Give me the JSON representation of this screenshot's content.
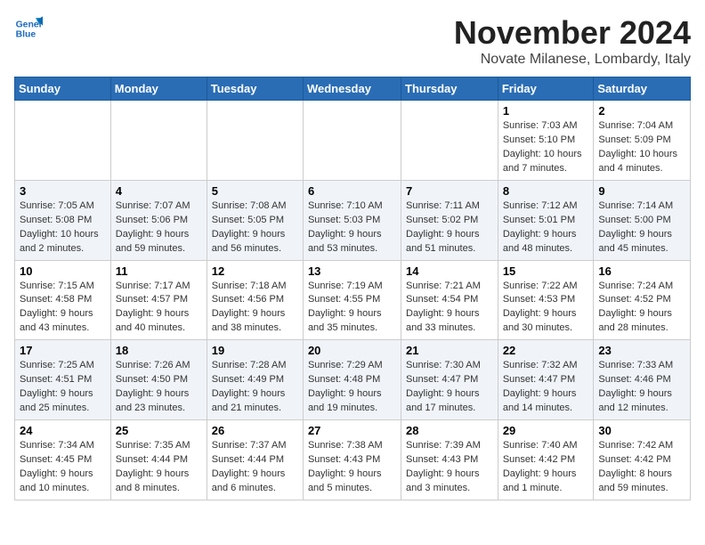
{
  "logo": {
    "line1": "General",
    "line2": "Blue"
  },
  "title": "November 2024",
  "location": "Novate Milanese, Lombardy, Italy",
  "headers": [
    "Sunday",
    "Monday",
    "Tuesday",
    "Wednesday",
    "Thursday",
    "Friday",
    "Saturday"
  ],
  "rows": [
    [
      {
        "day": "",
        "info": ""
      },
      {
        "day": "",
        "info": ""
      },
      {
        "day": "",
        "info": ""
      },
      {
        "day": "",
        "info": ""
      },
      {
        "day": "",
        "info": ""
      },
      {
        "day": "1",
        "info": "Sunrise: 7:03 AM\nSunset: 5:10 PM\nDaylight: 10 hours and 7 minutes."
      },
      {
        "day": "2",
        "info": "Sunrise: 7:04 AM\nSunset: 5:09 PM\nDaylight: 10 hours and 4 minutes."
      }
    ],
    [
      {
        "day": "3",
        "info": "Sunrise: 7:05 AM\nSunset: 5:08 PM\nDaylight: 10 hours and 2 minutes."
      },
      {
        "day": "4",
        "info": "Sunrise: 7:07 AM\nSunset: 5:06 PM\nDaylight: 9 hours and 59 minutes."
      },
      {
        "day": "5",
        "info": "Sunrise: 7:08 AM\nSunset: 5:05 PM\nDaylight: 9 hours and 56 minutes."
      },
      {
        "day": "6",
        "info": "Sunrise: 7:10 AM\nSunset: 5:03 PM\nDaylight: 9 hours and 53 minutes."
      },
      {
        "day": "7",
        "info": "Sunrise: 7:11 AM\nSunset: 5:02 PM\nDaylight: 9 hours and 51 minutes."
      },
      {
        "day": "8",
        "info": "Sunrise: 7:12 AM\nSunset: 5:01 PM\nDaylight: 9 hours and 48 minutes."
      },
      {
        "day": "9",
        "info": "Sunrise: 7:14 AM\nSunset: 5:00 PM\nDaylight: 9 hours and 45 minutes."
      }
    ],
    [
      {
        "day": "10",
        "info": "Sunrise: 7:15 AM\nSunset: 4:58 PM\nDaylight: 9 hours and 43 minutes."
      },
      {
        "day": "11",
        "info": "Sunrise: 7:17 AM\nSunset: 4:57 PM\nDaylight: 9 hours and 40 minutes."
      },
      {
        "day": "12",
        "info": "Sunrise: 7:18 AM\nSunset: 4:56 PM\nDaylight: 9 hours and 38 minutes."
      },
      {
        "day": "13",
        "info": "Sunrise: 7:19 AM\nSunset: 4:55 PM\nDaylight: 9 hours and 35 minutes."
      },
      {
        "day": "14",
        "info": "Sunrise: 7:21 AM\nSunset: 4:54 PM\nDaylight: 9 hours and 33 minutes."
      },
      {
        "day": "15",
        "info": "Sunrise: 7:22 AM\nSunset: 4:53 PM\nDaylight: 9 hours and 30 minutes."
      },
      {
        "day": "16",
        "info": "Sunrise: 7:24 AM\nSunset: 4:52 PM\nDaylight: 9 hours and 28 minutes."
      }
    ],
    [
      {
        "day": "17",
        "info": "Sunrise: 7:25 AM\nSunset: 4:51 PM\nDaylight: 9 hours and 25 minutes."
      },
      {
        "day": "18",
        "info": "Sunrise: 7:26 AM\nSunset: 4:50 PM\nDaylight: 9 hours and 23 minutes."
      },
      {
        "day": "19",
        "info": "Sunrise: 7:28 AM\nSunset: 4:49 PM\nDaylight: 9 hours and 21 minutes."
      },
      {
        "day": "20",
        "info": "Sunrise: 7:29 AM\nSunset: 4:48 PM\nDaylight: 9 hours and 19 minutes."
      },
      {
        "day": "21",
        "info": "Sunrise: 7:30 AM\nSunset: 4:47 PM\nDaylight: 9 hours and 17 minutes."
      },
      {
        "day": "22",
        "info": "Sunrise: 7:32 AM\nSunset: 4:47 PM\nDaylight: 9 hours and 14 minutes."
      },
      {
        "day": "23",
        "info": "Sunrise: 7:33 AM\nSunset: 4:46 PM\nDaylight: 9 hours and 12 minutes."
      }
    ],
    [
      {
        "day": "24",
        "info": "Sunrise: 7:34 AM\nSunset: 4:45 PM\nDaylight: 9 hours and 10 minutes."
      },
      {
        "day": "25",
        "info": "Sunrise: 7:35 AM\nSunset: 4:44 PM\nDaylight: 9 hours and 8 minutes."
      },
      {
        "day": "26",
        "info": "Sunrise: 7:37 AM\nSunset: 4:44 PM\nDaylight: 9 hours and 6 minutes."
      },
      {
        "day": "27",
        "info": "Sunrise: 7:38 AM\nSunset: 4:43 PM\nDaylight: 9 hours and 5 minutes."
      },
      {
        "day": "28",
        "info": "Sunrise: 7:39 AM\nSunset: 4:43 PM\nDaylight: 9 hours and 3 minutes."
      },
      {
        "day": "29",
        "info": "Sunrise: 7:40 AM\nSunset: 4:42 PM\nDaylight: 9 hours and 1 minute."
      },
      {
        "day": "30",
        "info": "Sunrise: 7:42 AM\nSunset: 4:42 PM\nDaylight: 8 hours and 59 minutes."
      }
    ]
  ]
}
